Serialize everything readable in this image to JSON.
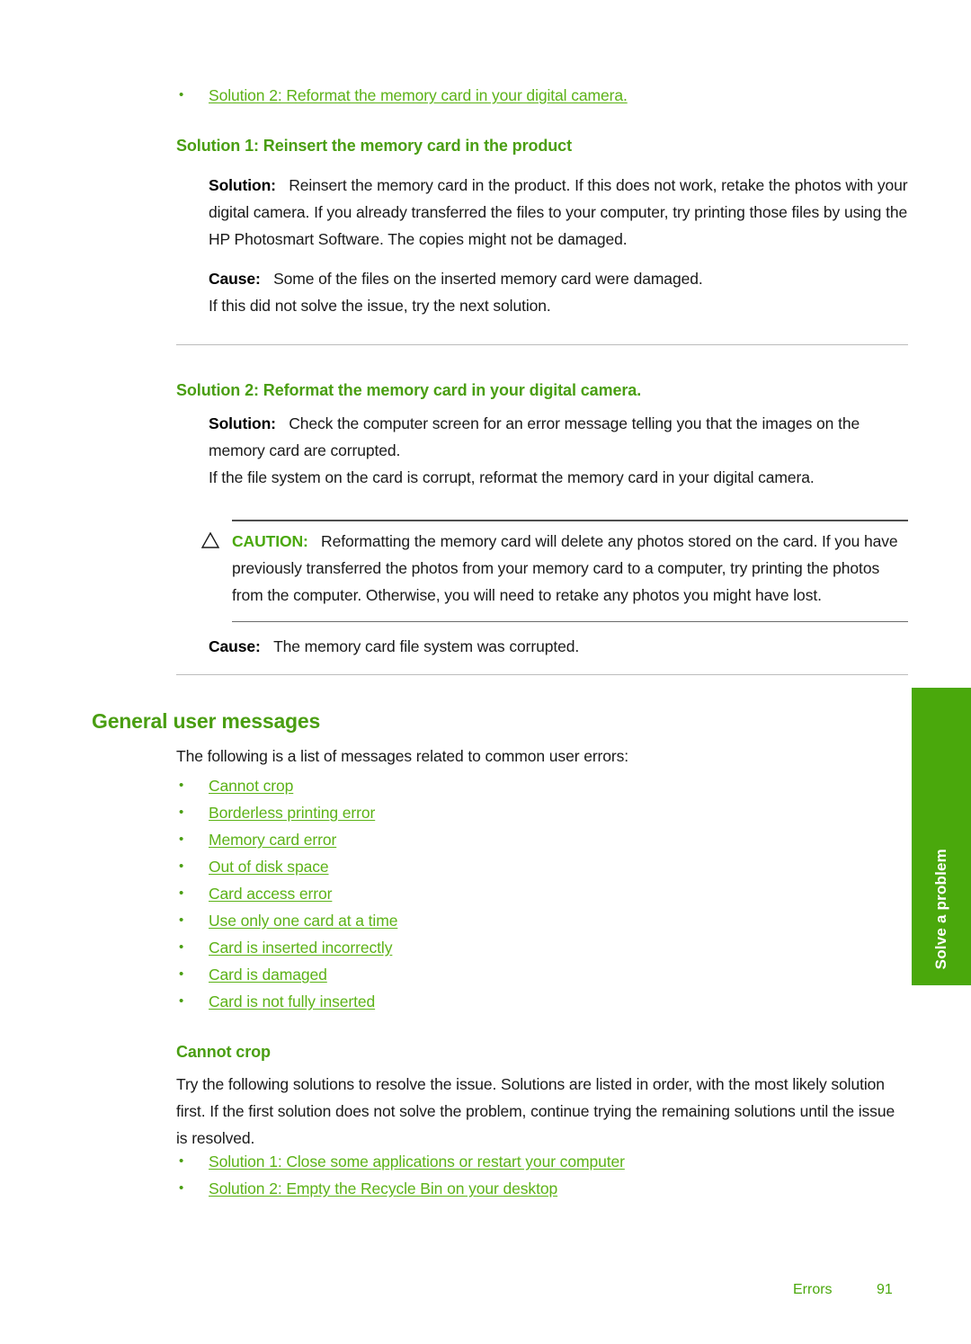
{
  "page": {
    "accent_green": "#4a9e12",
    "link_green": "#5cb217",
    "tab_green": "#4aa80c",
    "rule_gray": "#bcbcbc"
  },
  "top_link_list": {
    "items": [
      {
        "bullet": "•",
        "label": "Solution 2: Reformat the memory card in your digital camera."
      }
    ]
  },
  "solution1": {
    "heading": "Solution 1: Reinsert the memory card in the product",
    "solution_label": "Solution:",
    "solution_text": "Reinsert the memory card in the product. If this does not work, retake the photos with your digital camera. If you already transferred the files to your computer, try printing those files by using the HP Photosmart Software. The copies might not be damaged.",
    "cause_label": "Cause:",
    "cause_text": "Some of the files on the inserted memory card were damaged.",
    "next_text": "If this did not solve the issue, try the next solution."
  },
  "solution2": {
    "heading": "Solution 2: Reformat the memory card in your digital camera.",
    "solution_label": "Solution:",
    "solution_text": "Check the computer screen for an error message telling you that the images on the memory card are corrupted.",
    "body_text": "If the file system on the card is corrupt, reformat the memory card in your digital camera.",
    "caution_label": "CAUTION:",
    "caution_icon": "warning-triangle-icon",
    "caution_text": "Reformatting the memory card will delete any photos stored on the card. If you have previously transferred the photos from your memory card to a computer, try printing the photos from the computer. Otherwise, you will need to retake any photos you might have lost.",
    "cause_label": "Cause:",
    "cause_text": "The memory card file system was corrupted."
  },
  "general_user_messages": {
    "heading": "General user messages",
    "intro": "The following is a list of messages related to common user errors:",
    "links": [
      {
        "bullet": "•",
        "label": "Cannot crop"
      },
      {
        "bullet": "•",
        "label": "Borderless printing error"
      },
      {
        "bullet": "•",
        "label": "Memory card error"
      },
      {
        "bullet": "•",
        "label": "Out of disk space"
      },
      {
        "bullet": "•",
        "label": "Card access error"
      },
      {
        "bullet": "•",
        "label": "Use only one card at a time"
      },
      {
        "bullet": "•",
        "label": "Card is inserted incorrectly"
      },
      {
        "bullet": "•",
        "label": "Card is damaged"
      },
      {
        "bullet": "•",
        "label": "Card is not fully inserted"
      }
    ]
  },
  "cannot_crop": {
    "heading": "Cannot crop",
    "body": "Try the following solutions to resolve the issue. Solutions are listed in order, with the most likely solution first. If the first solution does not solve the problem, continue trying the remaining solutions until the issue is resolved.",
    "links": [
      {
        "bullet": "•",
        "label": "Solution 1: Close some applications or restart your computer"
      },
      {
        "bullet": "•",
        "label": "Solution 2: Empty the Recycle Bin on your desktop"
      }
    ]
  },
  "side_tab": {
    "label": "Solve a problem"
  },
  "footer": {
    "section": "Errors",
    "page_number": "91"
  }
}
